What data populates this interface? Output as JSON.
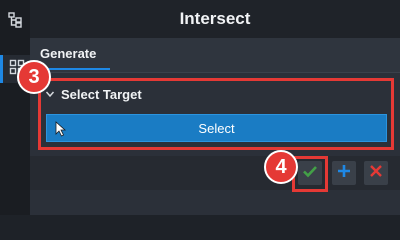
{
  "title": "Intersect",
  "tabs": [
    {
      "label": "Generate"
    }
  ],
  "section": {
    "label": "Select Target",
    "button_label": "Select"
  },
  "badges": {
    "step3": "3",
    "step4": "4"
  },
  "icons": {
    "rail_top": "tree-hierarchy-icon",
    "rail_active": "grid-icon",
    "collapse": "chevron-down-icon",
    "cursor": "mouse-pointer-icon",
    "ok": "checkmark-icon",
    "add": "plus-icon",
    "cancel": "close-icon"
  },
  "colors": {
    "accent": "#1e88e5",
    "highlight": "#e53935",
    "ok": "#43a047",
    "cancel": "#e53935"
  }
}
